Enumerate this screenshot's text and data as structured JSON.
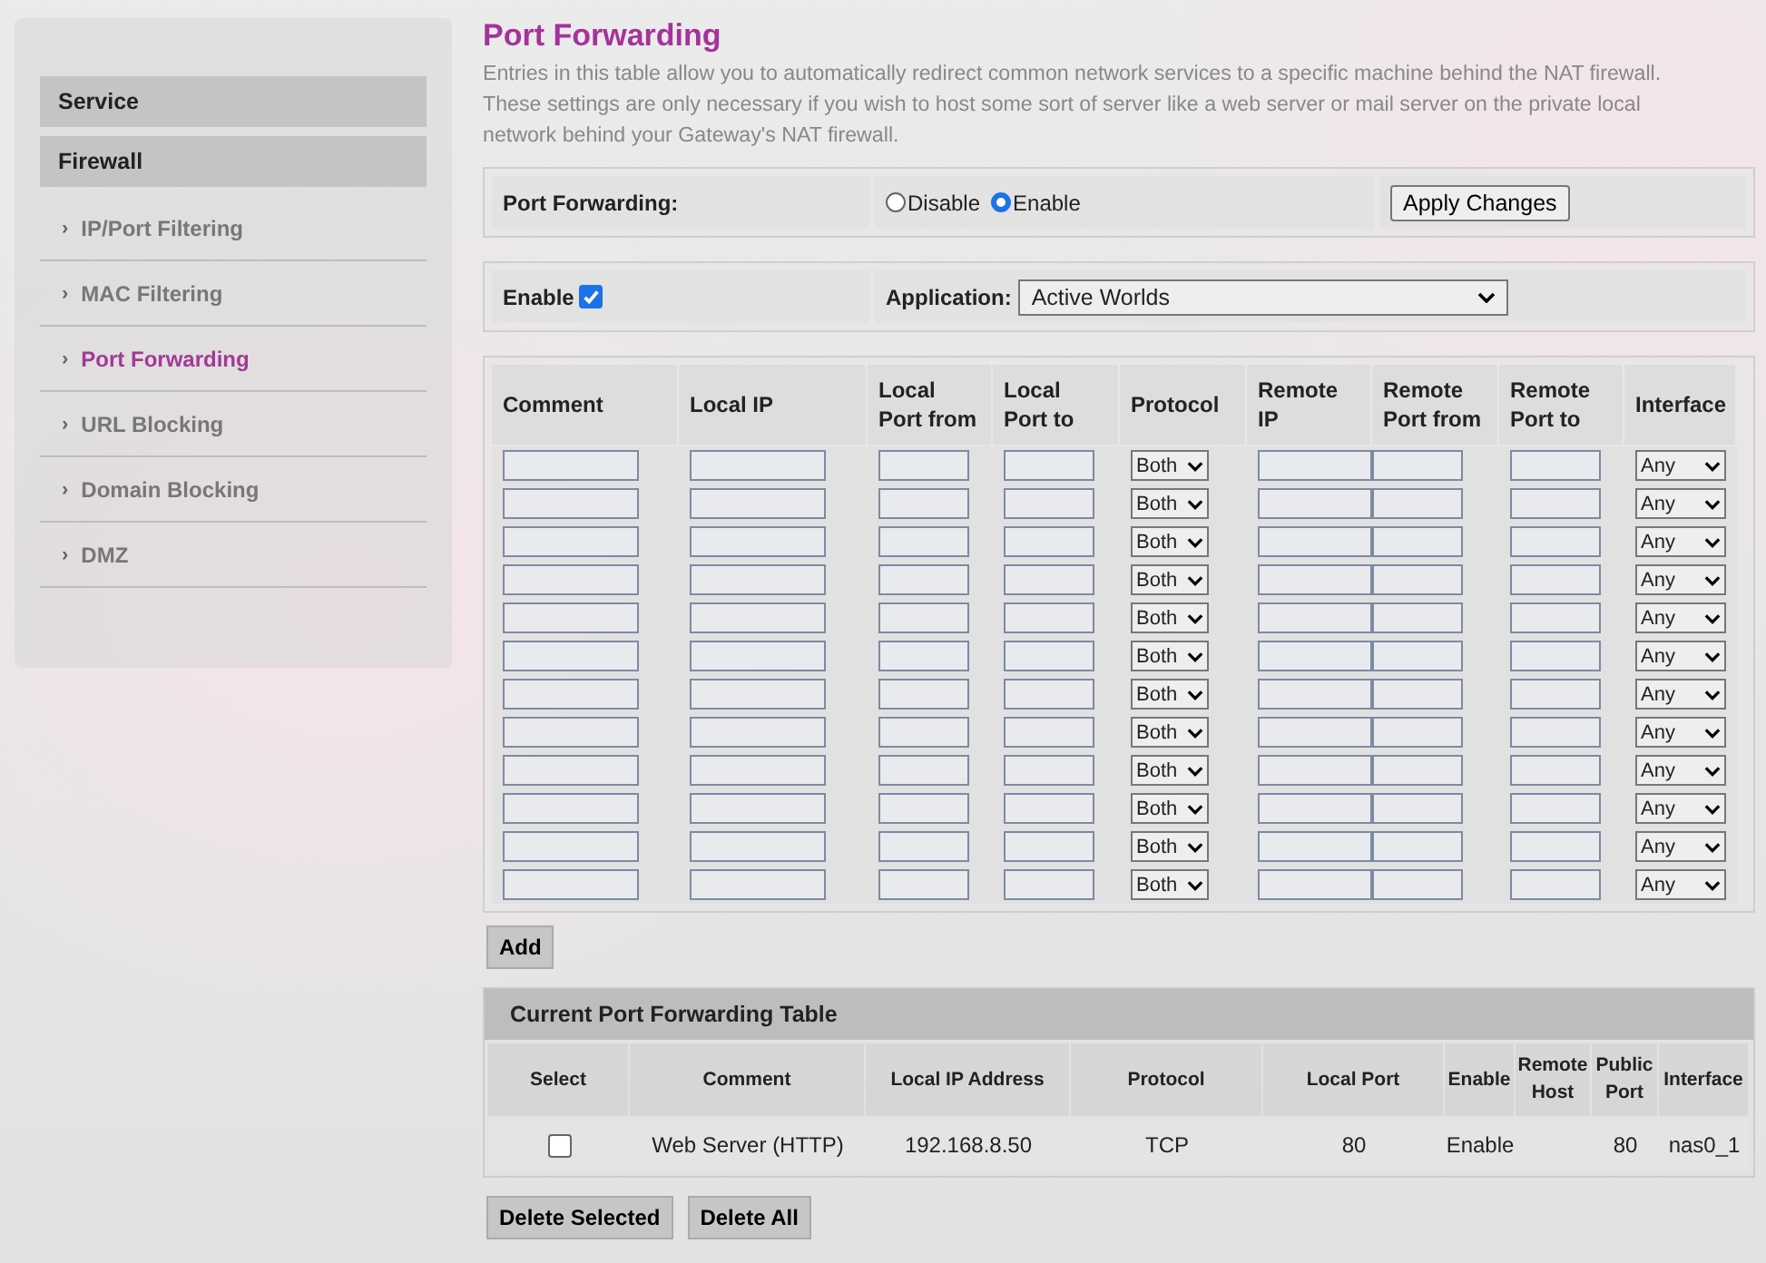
{
  "sidebar": {
    "sections": [
      {
        "title": "Service"
      },
      {
        "title": "Firewall",
        "items": [
          {
            "label": "IP/Port Filtering",
            "selected": false
          },
          {
            "label": "MAC Filtering",
            "selected": false
          },
          {
            "label": "Port Forwarding",
            "selected": true
          },
          {
            "label": "URL Blocking",
            "selected": false
          },
          {
            "label": "Domain Blocking",
            "selected": false
          },
          {
            "label": "DMZ",
            "selected": false
          }
        ]
      }
    ],
    "bullet": "›"
  },
  "page": {
    "title": "Port Forwarding",
    "description": "Entries in this table allow you to automatically redirect common network services to a specific machine behind the NAT firewall. These settings are only necessary if you wish to host some sort of server like a web server or mail server on the private local network behind your Gateway's NAT firewall."
  },
  "port_forwarding": {
    "label": "Port Forwarding:",
    "options": [
      {
        "label": "Disable",
        "selected": false
      },
      {
        "label": "Enable",
        "selected": true
      }
    ],
    "apply_button": "Apply Changes"
  },
  "enable": {
    "label": "Enable",
    "checked": true
  },
  "application": {
    "label": "Application:",
    "value": "Active Worlds"
  },
  "entry_table": {
    "columns": [
      "Comment",
      "Local IP",
      "Local Port from",
      "Local Port to",
      "Protocol",
      "Remote IP",
      "Remote Port from",
      "Remote Port to",
      "Interface"
    ],
    "rows": [
      {
        "protocol": "Both",
        "interface": "Any"
      },
      {
        "protocol": "Both",
        "interface": "Any"
      },
      {
        "protocol": "Both",
        "interface": "Any"
      },
      {
        "protocol": "Both",
        "interface": "Any"
      },
      {
        "protocol": "Both",
        "interface": "Any"
      },
      {
        "protocol": "Both",
        "interface": "Any"
      },
      {
        "protocol": "Both",
        "interface": "Any"
      },
      {
        "protocol": "Both",
        "interface": "Any"
      },
      {
        "protocol": "Both",
        "interface": "Any"
      },
      {
        "protocol": "Both",
        "interface": "Any"
      },
      {
        "protocol": "Both",
        "interface": "Any"
      },
      {
        "protocol": "Both",
        "interface": "Any"
      }
    ]
  },
  "add_button": "Add",
  "current_table": {
    "title": "Current Port Forwarding Table",
    "columns": [
      "Select",
      "Comment",
      "Local IP Address",
      "Protocol",
      "Local Port",
      "Enable",
      "Remote Host",
      "Public Port",
      "Interface"
    ],
    "rows": [
      {
        "checked": false,
        "comment": "Web Server (HTTP)",
        "local_ip": "192.168.8.50",
        "protocol": "TCP",
        "local_port": "80",
        "enable": "Enable",
        "public_port": "80",
        "interface": "nas0_1"
      }
    ]
  },
  "buttons": [
    "Delete Selected",
    "Delete All"
  ]
}
